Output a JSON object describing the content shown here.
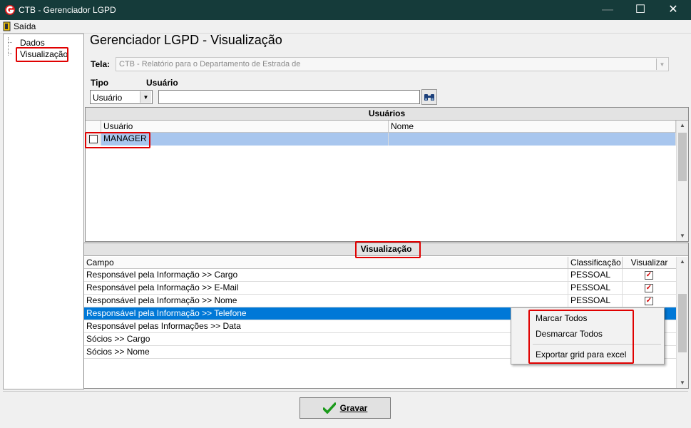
{
  "window": {
    "title": "CTB - Gerenciador LGPD"
  },
  "menu": {
    "saida": "Saída"
  },
  "tree": {
    "items": [
      {
        "label": "Dados"
      },
      {
        "label": "Visualização"
      }
    ]
  },
  "page": {
    "title": "Gerenciador LGPD - Visualização"
  },
  "tela": {
    "label": "Tela:",
    "value": "CTB - Relatório para o Departamento de Estrada de"
  },
  "tipo": {
    "label": "Tipo",
    "value": "Usuário"
  },
  "usuario": {
    "label": "Usuário",
    "value": ""
  },
  "users_grid": {
    "title": "Usuários",
    "columns": [
      "Usuário",
      "Nome"
    ],
    "rows": [
      {
        "usuario": "MANAGER",
        "nome": "",
        "checked": false
      }
    ]
  },
  "vis_grid": {
    "title": "Visualização",
    "columns": [
      "Campo",
      "Classificação",
      "Visualizar"
    ],
    "rows": [
      {
        "campo": "Responsável pela Informação >> Cargo",
        "classificacao": "PESSOAL",
        "visualizar": true
      },
      {
        "campo": "Responsável pela Informação >> E-Mail",
        "classificacao": "PESSOAL",
        "visualizar": true
      },
      {
        "campo": "Responsável pela Informação >> Nome",
        "classificacao": "PESSOAL",
        "visualizar": true
      },
      {
        "campo": "Responsável pela Informação >> Telefone",
        "classificacao": "",
        "visualizar": null
      },
      {
        "campo": "Responsável pelas Informações >> Data",
        "classificacao": "",
        "visualizar": null
      },
      {
        "campo": "Sócios >> Cargo",
        "classificacao": "",
        "visualizar": null
      },
      {
        "campo": "Sócios >> Nome",
        "classificacao": "",
        "visualizar": null
      }
    ]
  },
  "context_menu": {
    "items": [
      "Marcar Todos",
      "Desmarcar Todos",
      "Exportar grid para excel"
    ]
  },
  "footer": {
    "gravar": "Gravar"
  },
  "colors": {
    "titlebar": "#153b3a",
    "selection": "#0078d7",
    "highlight_box": "#e00000",
    "check": "#d40000",
    "ok_green": "#1a9a1a"
  },
  "icons": {
    "logo": "g-logo-icon",
    "exit": "exit-door-icon",
    "search": "binoculars-icon",
    "confirm": "green-check-icon"
  }
}
